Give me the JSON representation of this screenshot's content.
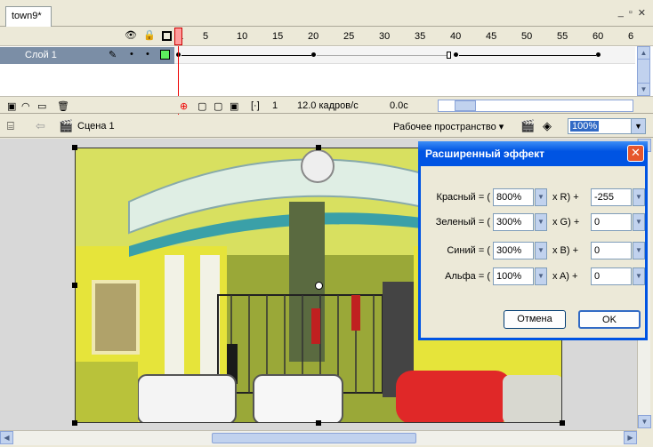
{
  "document": {
    "tab_label": "town9*",
    "window_controls": [
      "_",
      "▫",
      "✕"
    ]
  },
  "timeline": {
    "header_icons": [
      "eye-icon",
      "lock-icon",
      "outline-icon"
    ],
    "ruler": [
      "1",
      "5",
      "10",
      "15",
      "20",
      "25",
      "30",
      "35",
      "40",
      "45",
      "50",
      "55",
      "60",
      "6"
    ],
    "layer": {
      "name": "Слой 1",
      "color": "#5df05d"
    },
    "footer": {
      "frame": "1",
      "fps": "12.0 кадров/с",
      "time": "0.0с"
    }
  },
  "editbar": {
    "scene": "Сцена 1",
    "workspace": "Рабочее пространство ▾",
    "zoom": "100%"
  },
  "dialog": {
    "title": "Расширенный эффект",
    "rows": [
      {
        "label": "Красный = (",
        "percent": "800%",
        "op": "x R) +",
        "offset": "-255"
      },
      {
        "label": "Зеленый = (",
        "percent": "300%",
        "op": "x G) +",
        "offset": "0"
      },
      {
        "label": "Синий = (",
        "percent": "300%",
        "op": "x B) +",
        "offset": "0"
      },
      {
        "label": "Альфа = (",
        "percent": "100%",
        "op": "x A) +",
        "offset": "0"
      }
    ],
    "cancel": "Отмена",
    "ok": "OK"
  },
  "colors": {
    "accent": "#0054e3",
    "layer_highlight": "#7b8ea6",
    "playhead": "#e00000"
  }
}
